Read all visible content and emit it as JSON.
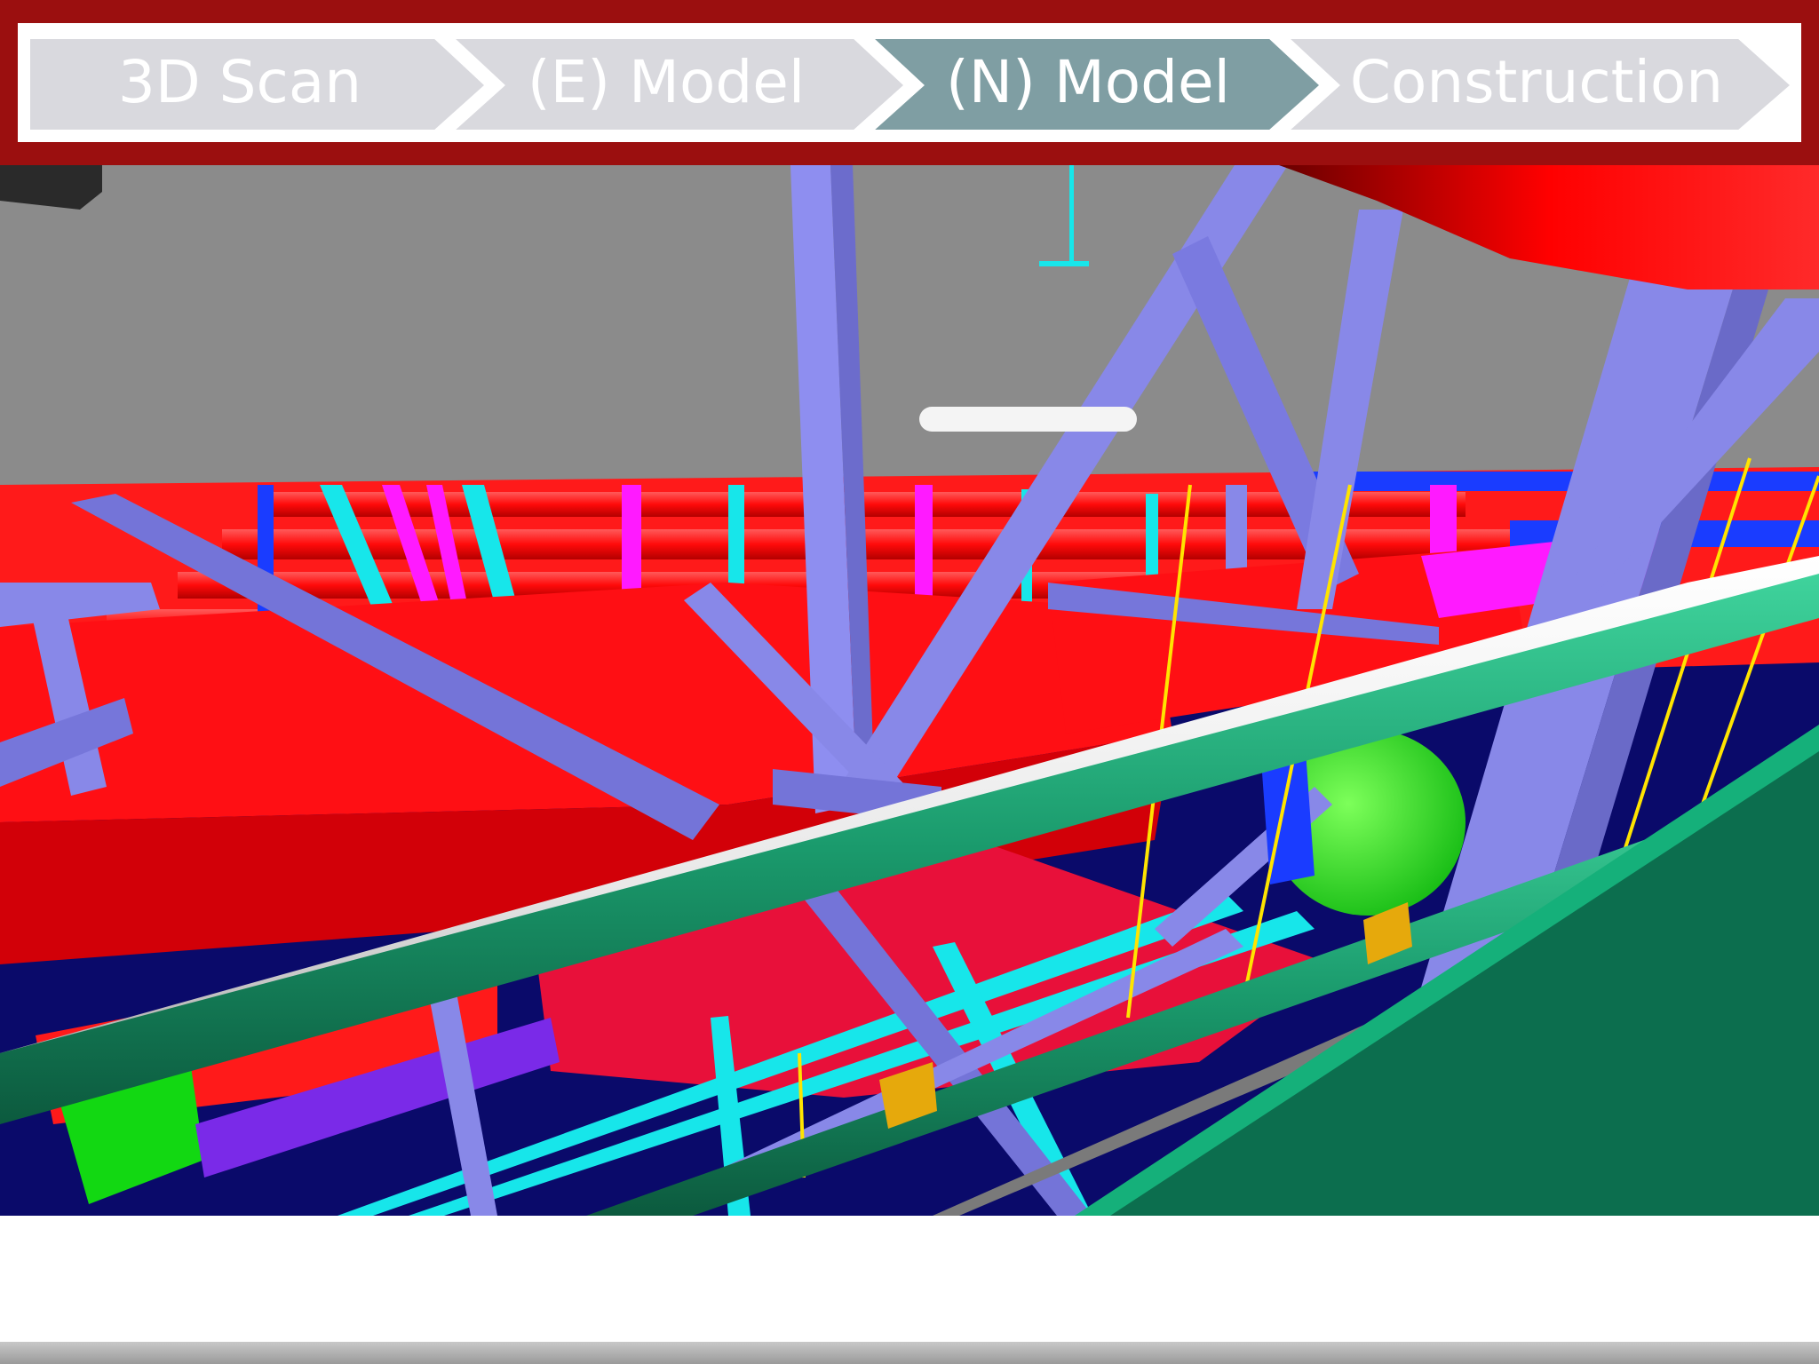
{
  "workflow": {
    "steps": [
      {
        "label": "3D Scan",
        "state": "inactive"
      },
      {
        "label": "(E) Model",
        "state": "inactive"
      },
      {
        "label": "(N) Model",
        "state": "active"
      },
      {
        "label": "Construction",
        "state": "inactive"
      }
    ]
  },
  "colors": {
    "header_red": "#9b0f0f",
    "step_inactive": "#d9d9de",
    "step_active": "#7f9ea3",
    "steel_members": "#8888e8",
    "piping_red": "#ff0f14",
    "pipe_green": "#1ea274",
    "pipe_white": "#f2f2f2",
    "cyan_members": "#17e6ea",
    "magenta_members": "#ff1aff",
    "floor_navy": "#080866",
    "ceiling_gray": "#8a8a8a",
    "wall_green": "#0c6e4e"
  },
  "viewport": {
    "content": "3D MEP coordination model view"
  }
}
